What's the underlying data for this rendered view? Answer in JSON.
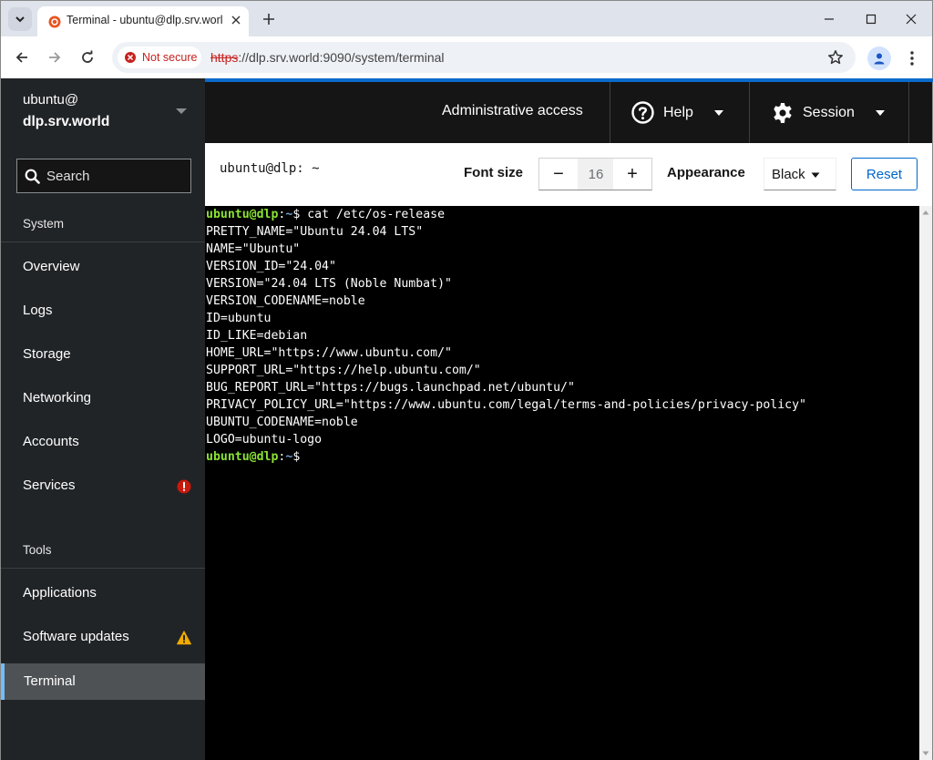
{
  "browser": {
    "tab_title": "Terminal - ubuntu@dlp.srv.world",
    "security_label": "Not secure",
    "url_scheme": "https",
    "url_rest": "://dlp.srv.world:9090/system/terminal"
  },
  "sidebar": {
    "host_user": "ubuntu@",
    "host_name": "dlp.srv.world",
    "search_label": "Search",
    "section_system": "System",
    "system_items": [
      {
        "label": "Overview"
      },
      {
        "label": "Logs"
      },
      {
        "label": "Storage"
      },
      {
        "label": "Networking"
      },
      {
        "label": "Accounts"
      },
      {
        "label": "Services",
        "badge": "error"
      }
    ],
    "section_tools": "Tools",
    "tools_items": [
      {
        "label": "Applications"
      },
      {
        "label": "Software updates",
        "badge": "warning"
      },
      {
        "label": "Terminal",
        "active": true
      }
    ]
  },
  "masthead": {
    "admin_access": "Administrative access",
    "help_label": "Help",
    "session_label": "Session"
  },
  "terminal_header": {
    "title": "ubuntu@dlp: ~",
    "font_size_label": "Font size",
    "font_size_value": "16",
    "minus_label": "−",
    "plus_label": "+",
    "appearance_label": "Appearance",
    "appearance_value": "Black",
    "reset_label": "Reset"
  },
  "terminal": {
    "prompt_user": "ubuntu@dlp",
    "prompt_sep": ":",
    "prompt_path": "~",
    "prompt_symbol": "$",
    "command": " cat /etc/os-release",
    "output": [
      "PRETTY_NAME=\"Ubuntu 24.04 LTS\"",
      "NAME=\"Ubuntu\"",
      "VERSION_ID=\"24.04\"",
      "VERSION=\"24.04 LTS (Noble Numbat)\"",
      "VERSION_CODENAME=noble",
      "ID=ubuntu",
      "ID_LIKE=debian",
      "HOME_URL=\"https://www.ubuntu.com/\"",
      "SUPPORT_URL=\"https://help.ubuntu.com/\"",
      "BUG_REPORT_URL=\"https://bugs.launchpad.net/ubuntu/\"",
      "PRIVACY_POLICY_URL=\"https://www.ubuntu.com/legal/terms-and-policies/privacy-policy\"",
      "UBUNTU_CODENAME=noble",
      "LOGO=ubuntu-logo"
    ]
  },
  "colors": {
    "sidebar_bg": "#212427",
    "masthead_bg": "#151515",
    "accent": "#0066cc",
    "prompt_green": "#8ae234",
    "prompt_blue": "#729fcf",
    "error_badge": "#c9190b",
    "warning_badge": "#f0ab00"
  },
  "icons": {
    "tab_search": "chevron-down-icon",
    "favicon": "cockpit-icon",
    "security": "warning-circle-icon",
    "help": "question-circle-icon",
    "session": "gear-icon"
  }
}
